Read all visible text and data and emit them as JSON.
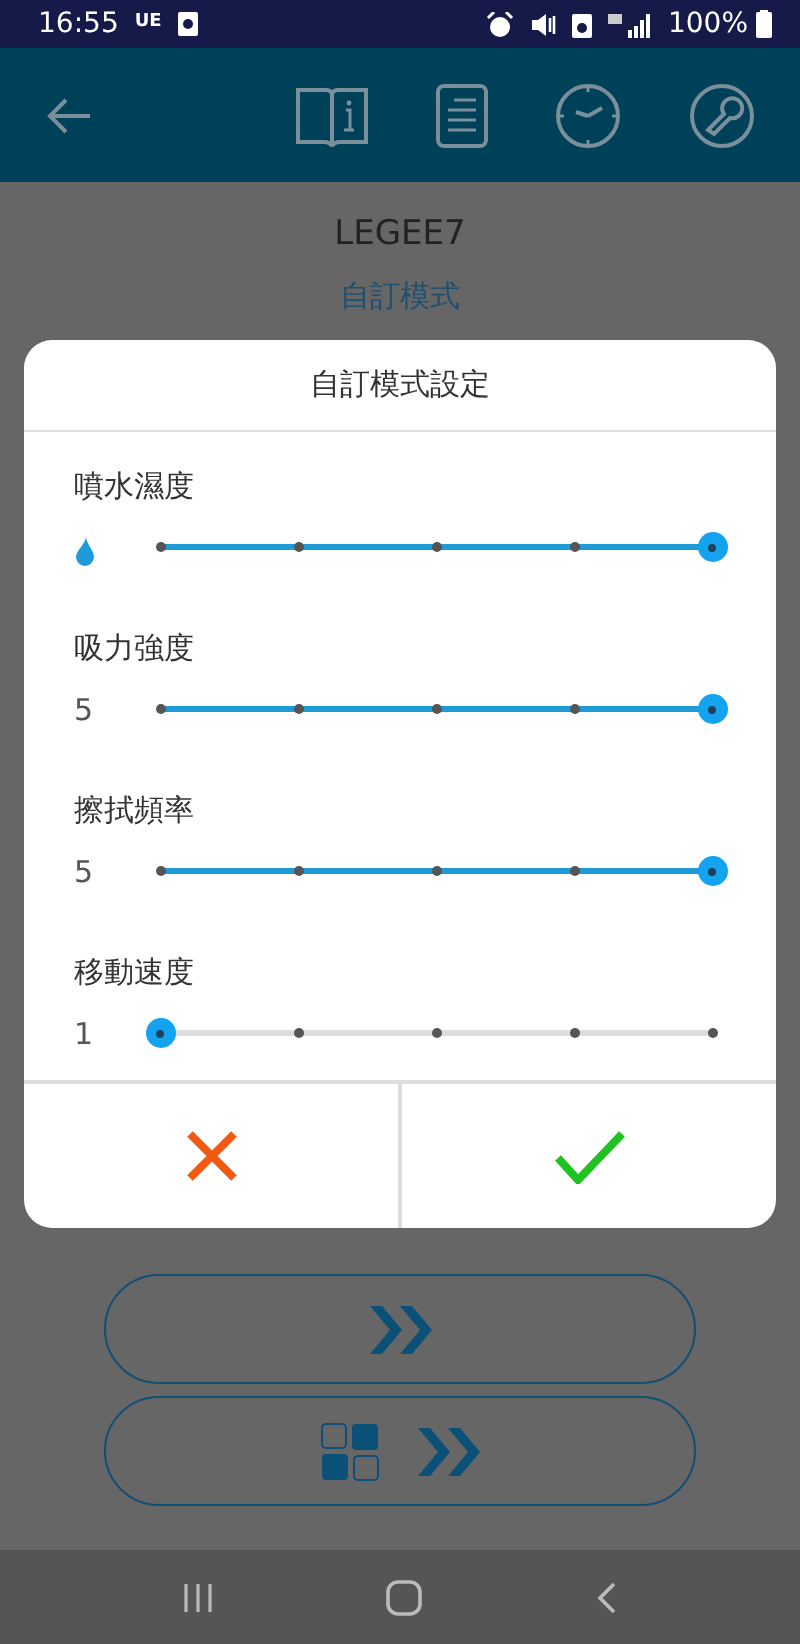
{
  "status_bar": {
    "time": "16:55",
    "carrier": "UE",
    "battery": "100%"
  },
  "device_name": "LEGEE7",
  "mode": "自訂模式",
  "dialog": {
    "title": "自訂模式設定",
    "sliders": [
      {
        "label": "噴水濕度",
        "kind": "icon",
        "level": 1
      },
      {
        "label": "吸力強度",
        "kind": "value",
        "value": "5",
        "level": 1
      },
      {
        "label": "擦拭頻率",
        "kind": "value",
        "value": "5",
        "level": 1
      },
      {
        "label": "移動速度",
        "kind": "value",
        "value": "1",
        "level": 0
      }
    ]
  }
}
